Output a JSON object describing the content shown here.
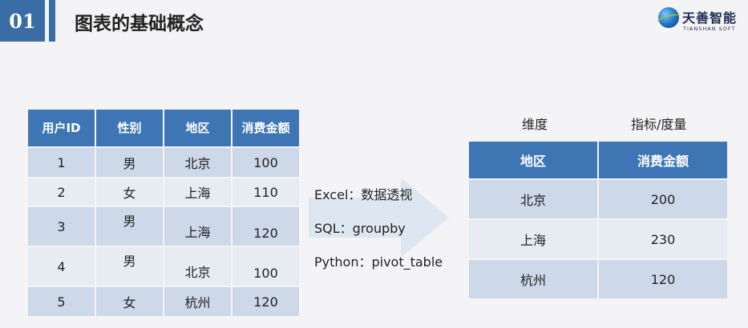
{
  "header": {
    "number": "01",
    "title": "图表的基础概念",
    "logo": {
      "name": "天善智能",
      "sub": "TIANSHAN SOFT"
    }
  },
  "raw_table": {
    "headers": [
      "用户ID",
      "性别",
      "地区",
      "消费金额"
    ],
    "rows": [
      [
        "1",
        "男",
        "北京",
        "100"
      ],
      [
        "2",
        "女",
        "上海",
        "110"
      ],
      [
        "3",
        "男",
        "上海",
        "120"
      ],
      [
        "4",
        "男",
        "北京",
        "100"
      ],
      [
        "5",
        "女",
        "杭州",
        "120"
      ]
    ]
  },
  "transform": {
    "methods": [
      "Excel：数据透视",
      "SQL：groupby",
      "Python：pivot_table"
    ]
  },
  "summary_table": {
    "dimension_label": "维度",
    "measure_label": "指标/度量",
    "headers": [
      "地区",
      "消费金额"
    ],
    "rows": [
      [
        "北京",
        "200"
      ],
      [
        "上海",
        "230"
      ],
      [
        "杭州",
        "120"
      ]
    ]
  },
  "colors": {
    "accent": "#3a6da6",
    "header_fill": "#3e76b5",
    "row_dark": "#cdd8e8",
    "row_light": "#e7ecf3",
    "arrow": "#dde7f1"
  }
}
